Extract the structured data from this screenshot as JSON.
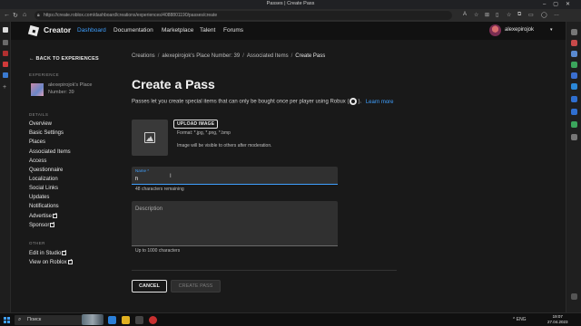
{
  "window": {
    "title": "Passes | Create Pass"
  },
  "browser": {
    "url": "https://create.roblox.com/dashboard/creations/experiences/4088801190/passes/create"
  },
  "header": {
    "brand": "Creator",
    "nav": [
      "Dashboard",
      "Documentation",
      "Marketplace",
      "Talent",
      "Forums"
    ],
    "active_nav": "Dashboard",
    "username": "alexepirojok",
    "user_caret": "▾"
  },
  "sidebar": {
    "back_label": "BACK TO EXPERIENCES",
    "experience_heading": "EXPERIENCE",
    "experience_name": "alexepirojok's Place Number: 39",
    "details_heading": "DETAILS",
    "details_items": [
      "Overview",
      "Basic Settings",
      "Places",
      "Associated Items",
      "Access",
      "Questionnaire",
      "Localization",
      "Social Links",
      "Updates",
      "Notifications",
      "Advertise",
      "Sponsor"
    ],
    "other_heading": "OTHER",
    "other_items": [
      "Edit in Studio",
      "View on Roblox"
    ]
  },
  "main": {
    "breadcrumb": [
      "Creations",
      "alexepirojok's Place Number: 39",
      "Associated Items",
      "Create Pass"
    ],
    "breadcrumb_sep": "/",
    "title": "Create a Pass",
    "intro": "Passes let you create special items that can only be bought once per player using Robux (",
    "intro_end": ").",
    "learn_more": "Learn more",
    "upload_button": "UPLOAD IMAGE",
    "format_text": "Format: *.jpg, *.png, *.bmp",
    "visibility_text": "Image will be visible to others after moderation.",
    "name_label": "Name *",
    "name_value": "h",
    "name_remaining": "48 characters remaining",
    "description_label": "Description",
    "description_limit": "Up to 1000 characters",
    "cancel_button": "CANCEL",
    "create_button": "CREATE PASS"
  },
  "taskbar": {
    "search_label": "Поиск",
    "tray_text": "^  ENG",
    "time": "19:07",
    "date": "27.04.2023"
  },
  "colors": {
    "accent": "#3fa0ff",
    "background": "#191919",
    "header": "#111111"
  }
}
